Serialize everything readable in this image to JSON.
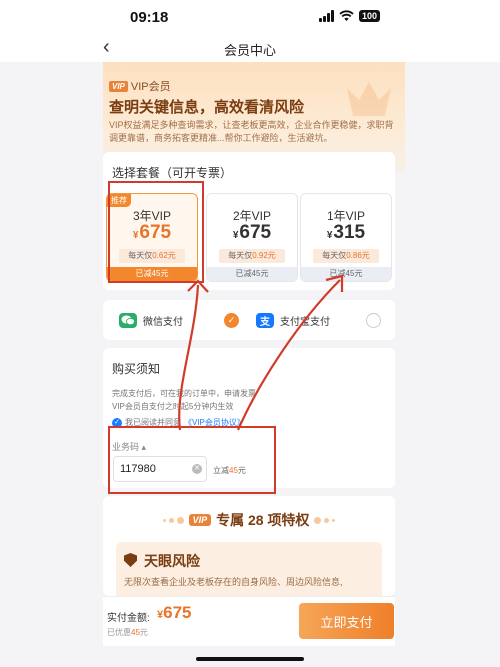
{
  "status_bar": {
    "time": "09:18",
    "battery": "100"
  },
  "nav": {
    "title": "会员中心"
  },
  "hero": {
    "vip_badge": "VIP",
    "vip_tag": "VIP会员",
    "title": "查明关键信息，高效看清风险",
    "desc": "VIP权益满足多种查询需求，让查老板更高效，企业合作更稳健，求职背调更靠谱，商务拓客更精准...帮你工作避险，生活避坑。"
  },
  "packages": {
    "title": "选择套餐（可开专票）",
    "items": [
      {
        "badge": "推荐",
        "name": "3年VIP",
        "currency": "¥",
        "price": "675",
        "daily_prefix": "每天仅",
        "daily_value": "0.62元",
        "saved": "已减45元",
        "selected": true
      },
      {
        "badge": "",
        "name": "2年VIP",
        "currency": "¥",
        "price": "675",
        "daily_prefix": "每天仅",
        "daily_value": "0.92元",
        "saved": "已减45元",
        "selected": false
      },
      {
        "badge": "",
        "name": "1年VIP",
        "currency": "¥",
        "price": "315",
        "daily_prefix": "每天仅",
        "daily_value": "0.86元",
        "saved": "已减45元",
        "selected": false
      }
    ]
  },
  "payment": {
    "options": [
      {
        "label": "微信支付",
        "icon": "wechat-icon",
        "color": "#2aae67",
        "checked": true
      },
      {
        "label": "支付宝支付",
        "icon": "alipay-icon",
        "color": "#1677ff",
        "checked": false
      }
    ]
  },
  "notice": {
    "title": "购买须知",
    "line1": "完成支付后，可在我的订单中，申请发票",
    "line2": "VIP会员自支付之时起5分钟内生效",
    "agree_prefix": "我已阅读并同意",
    "agree_link": "《VIP会员协议》",
    "code_label": "业务码",
    "code_value": "117980",
    "discount_prefix": "立减",
    "discount_amount": "45",
    "discount_suffix": "元"
  },
  "privileges": {
    "vip_badge": "VIP",
    "title_prefix": "专属",
    "count": "28",
    "title_suffix": "项特权",
    "risk_title": "天眼风险",
    "risk_desc": "无限次查看企业及老板存在的自身风险、周边风险信息,"
  },
  "bottom": {
    "paid_label": "实付金额:",
    "currency": "¥",
    "paid_amount": "675",
    "saved_prefix": "已优惠",
    "saved_amount": "45",
    "saved_suffix": "元",
    "pay_button": "立即支付"
  },
  "colors": {
    "accent": "#f2872e",
    "annotation": "#d23b2a"
  }
}
